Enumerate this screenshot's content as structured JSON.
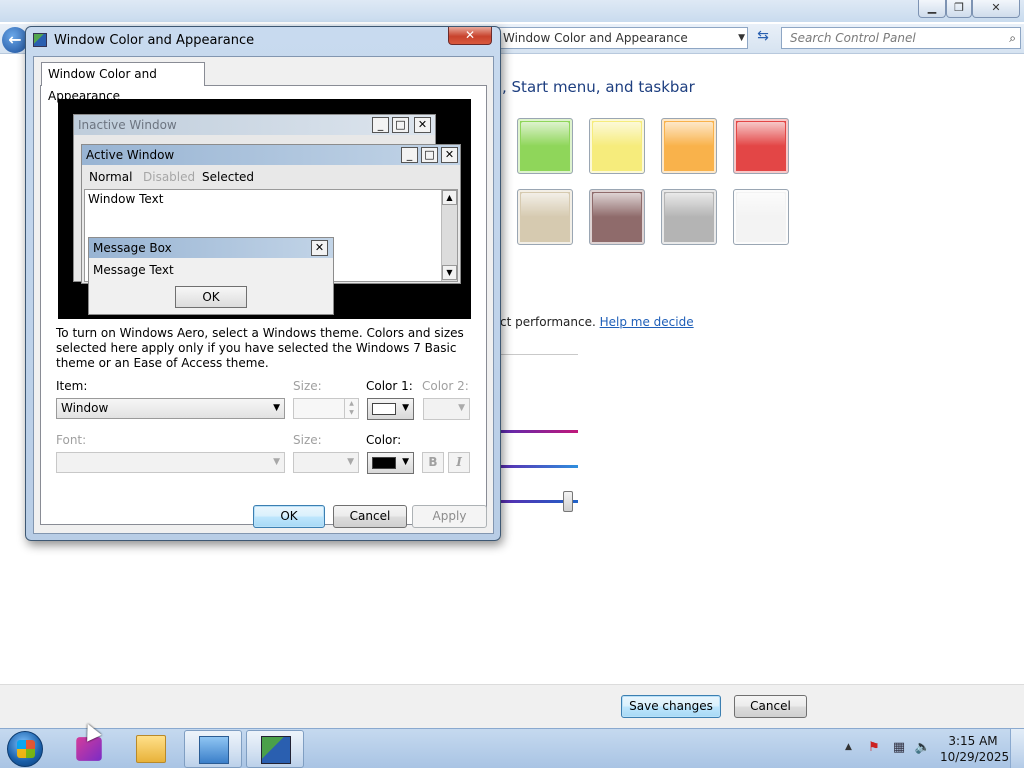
{
  "background": {
    "breadcrumb": "Window Color and Appearance",
    "search_placeholder": "Search Control Panel",
    "heading": ", Start menu, and taskbar",
    "perf_text": "ct performance.",
    "help_link": "Help me decide",
    "swatches": [
      "#8fd65a",
      "#f6ec7c",
      "#f9b24b",
      "#e34646",
      "#d6cab0",
      "#8f6b6b",
      "#b4b4b4",
      "#f3f3f3"
    ],
    "slider_colors": [
      "#c0187a",
      "#2f8fde",
      "#1f63c8"
    ],
    "save_label": "Save changes",
    "cancel_label": "Cancel"
  },
  "dialog": {
    "title": "Window Color and Appearance",
    "close_glyph": "✕",
    "tab": "Window Color and Appearance",
    "preview": {
      "inactive_title": "Inactive Window",
      "active_title": "Active Window",
      "menu_normal": "Normal",
      "menu_disabled": "Disabled",
      "menu_selected": "Selected",
      "window_text": "Window Text",
      "msgbox_title": "Message Box",
      "msg_text": "Message Text",
      "msg_ok": "OK"
    },
    "info": "To turn on Windows Aero, select a Windows theme.  Colors and sizes selected here apply only if you have selected the Windows 7 Basic theme or an Ease of Access theme.",
    "item_label": "Item:",
    "item_value": "Window",
    "size_label": "Size:",
    "color1_label": "Color 1:",
    "color2_label": "Color 2:",
    "color1_value": "#ffffff",
    "font_label": "Font:",
    "font_size_label": "Size:",
    "font_color_label": "Color:",
    "font_color_value": "#000000",
    "bold_label": "B",
    "italic_label": "I",
    "ok_label": "OK",
    "cancel_label": "Cancel",
    "apply_label": "Apply"
  },
  "taskbar": {
    "time": "3:15 AM",
    "date": "10/29/2025",
    "tray_up": "▲",
    "tray_action_center": "⚑",
    "tray_network": "▦",
    "tray_volume": "🔈"
  }
}
